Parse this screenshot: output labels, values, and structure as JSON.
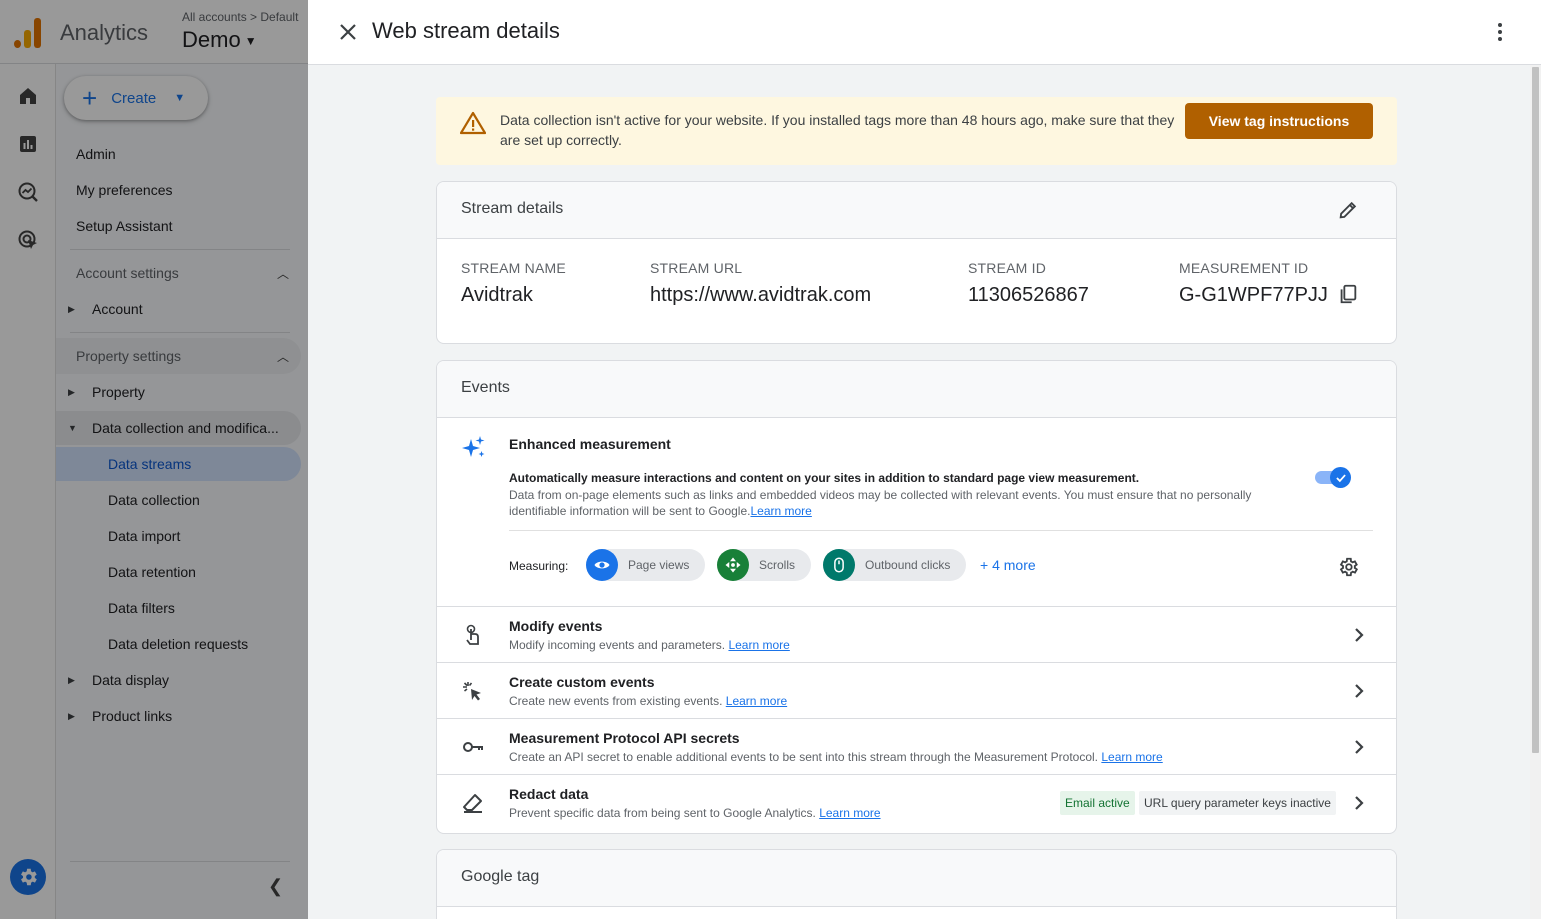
{
  "app": {
    "name": "Analytics",
    "account_crumb": "All accounts > Default",
    "account_name": "Demo"
  },
  "sidenav": {
    "create_label": "Create",
    "top_items": [
      "Admin",
      "My preferences",
      "Setup Assistant"
    ],
    "account_settings": {
      "label": "Account settings",
      "items": [
        "Account"
      ]
    },
    "property_settings": {
      "label": "Property settings",
      "property": "Property",
      "data_collection": "Data collection and modifica...",
      "data_collection_items": [
        "Data streams",
        "Data collection",
        "Data import",
        "Data retention",
        "Data filters",
        "Data deletion requests"
      ],
      "data_display": "Data display",
      "product_links": "Product links"
    }
  },
  "drawer": {
    "title": "Web stream details",
    "warning": {
      "text": "Data collection isn't active for your website. If you installed tags more than 48 hours ago, make sure that they are set up correctly.",
      "button": "View tag instructions"
    },
    "stream_details": {
      "title": "Stream details",
      "stream_name_label": "STREAM NAME",
      "stream_name": "Avidtrak",
      "stream_url_label": "STREAM URL",
      "stream_url": "https://www.avidtrak.com",
      "stream_id_label": "STREAM ID",
      "stream_id": "11306526867",
      "measurement_id_label": "MEASUREMENT ID",
      "measurement_id": "G-G1WPF77PJJ"
    },
    "events": {
      "title": "Events",
      "enhanced": {
        "title": "Enhanced measurement",
        "bold_desc": "Automatically measure interactions and content on your sites in addition to standard page view measurement.",
        "desc": "Data from on-page elements such as links and embedded videos may be collected with relevant events. You must ensure that no personally identifiable information will be sent to Google.",
        "learn_more": "Learn more",
        "enabled": true,
        "measuring_label": "Measuring:",
        "chips": [
          "Page views",
          "Scrolls",
          "Outbound clicks"
        ],
        "more": "+ 4 more"
      },
      "rows": [
        {
          "title": "Modify events",
          "desc": "Modify incoming events and parameters.",
          "link": "Learn more"
        },
        {
          "title": "Create custom events",
          "desc": "Create new events from existing events.",
          "link": "Learn more"
        },
        {
          "title": "Measurement Protocol API secrets",
          "desc": "Create an API secret to enable additional events to be sent into this stream through the Measurement Protocol.",
          "link": "Learn more"
        },
        {
          "title": "Redact data",
          "desc": "Prevent specific data from being sent to Google Analytics.",
          "link": "Learn more",
          "badge_email": "Email active",
          "badge_url": "URL query parameter keys inactive"
        }
      ]
    },
    "google_tag": {
      "title": "Google tag"
    }
  },
  "colors": {
    "accent": "#1a73e8",
    "warning_bg": "#fef7e0",
    "warning_button": "#b06000",
    "chip_page_views": "#1a73e8",
    "chip_scrolls": "#188038",
    "chip_outbound": "#00796b"
  }
}
